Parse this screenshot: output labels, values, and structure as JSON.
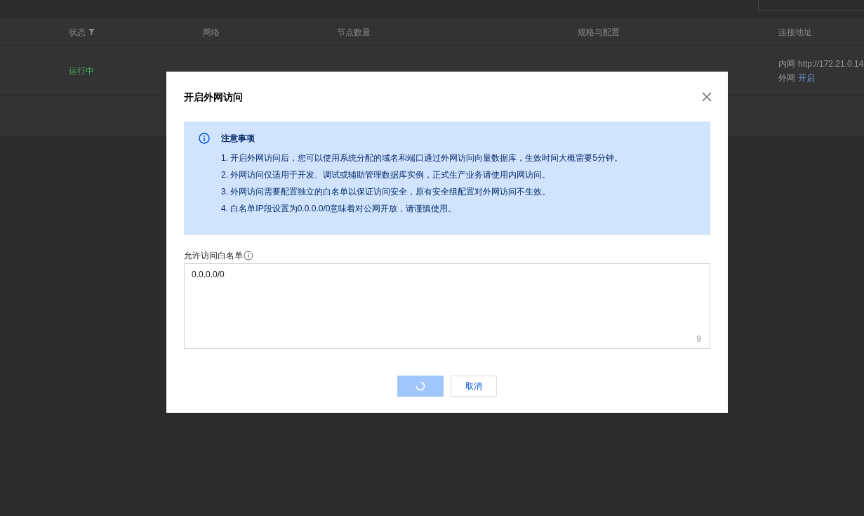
{
  "page": {
    "table": {
      "columns": [
        "状态",
        "网络",
        "节点数量",
        "规格与配置",
        "连接地址"
      ],
      "rows": [
        {
          "status": "运行中",
          "address": [
            {
              "label": "内网",
              "value": "http://172.21.0.14",
              "kind": "text"
            },
            {
              "label": "外网",
              "value": "开启",
              "kind": "link"
            }
          ]
        }
      ]
    }
  },
  "dialog": {
    "title": "开启外网访问",
    "notice": {
      "title": "注意事项",
      "items": [
        "1. 开启外网访问后，您可以使用系统分配的域名和端口通过外网访问向量数据库，生效时间大概需要5分钟。",
        "2. 外网访问仅适用于开发、调试或辅助管理数据库实例，正式生产业务请使用内网访问。",
        "3. 外网访问需要配置独立的白名单以保证访问安全，原有安全组配置对外网访问不生效。",
        "4. 白名单IP段设置为0.0.0.0/0意味着对公网开放，请谨慎使用。"
      ]
    },
    "whitelist": {
      "label": "允许访问白名单",
      "value": "0.0.0.0/0",
      "count": "9"
    },
    "confirm": {
      "loading": true
    },
    "cancel": "取消"
  }
}
